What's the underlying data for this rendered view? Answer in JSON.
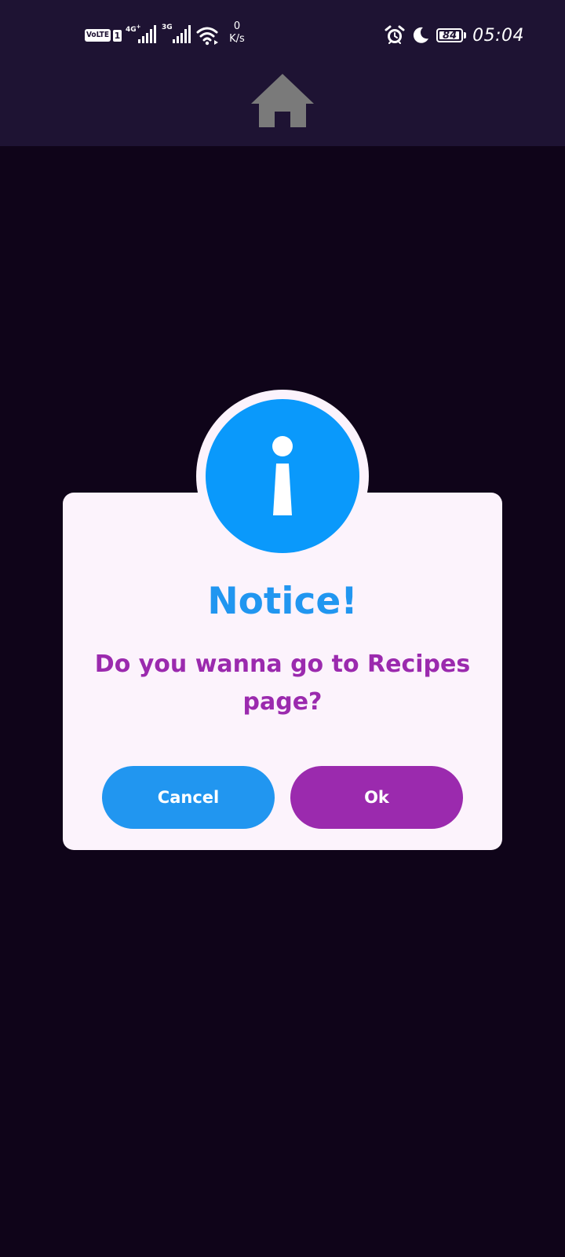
{
  "status_bar": {
    "volte_label": "VoLTE",
    "sim_label": "1",
    "network_1": "4G",
    "network_2": "3G",
    "speed_value": "0",
    "speed_unit": "K/s",
    "battery_level": "84",
    "time": "05:04",
    "icons": [
      "alarm-icon",
      "moon-icon",
      "battery-icon",
      "wifi-icon",
      "signal-icon"
    ]
  },
  "app_bar": {
    "icon": "home-icon",
    "icon_color": "#7a7a7a",
    "background": "#1e1333"
  },
  "dialog": {
    "icon": "info-icon",
    "icon_color": "#0a99fb",
    "title": "Notice!",
    "message": "Do you wanna go to Recipes page?",
    "cancel_label": "Cancel",
    "ok_label": "Ok",
    "title_color": "#2196f0",
    "message_color": "#9b2aae",
    "cancel_color": "#2196f0",
    "ok_color": "#9b2aae"
  },
  "colors": {
    "background": "#0f0419",
    "dialog_background": "#fcf3fc"
  }
}
